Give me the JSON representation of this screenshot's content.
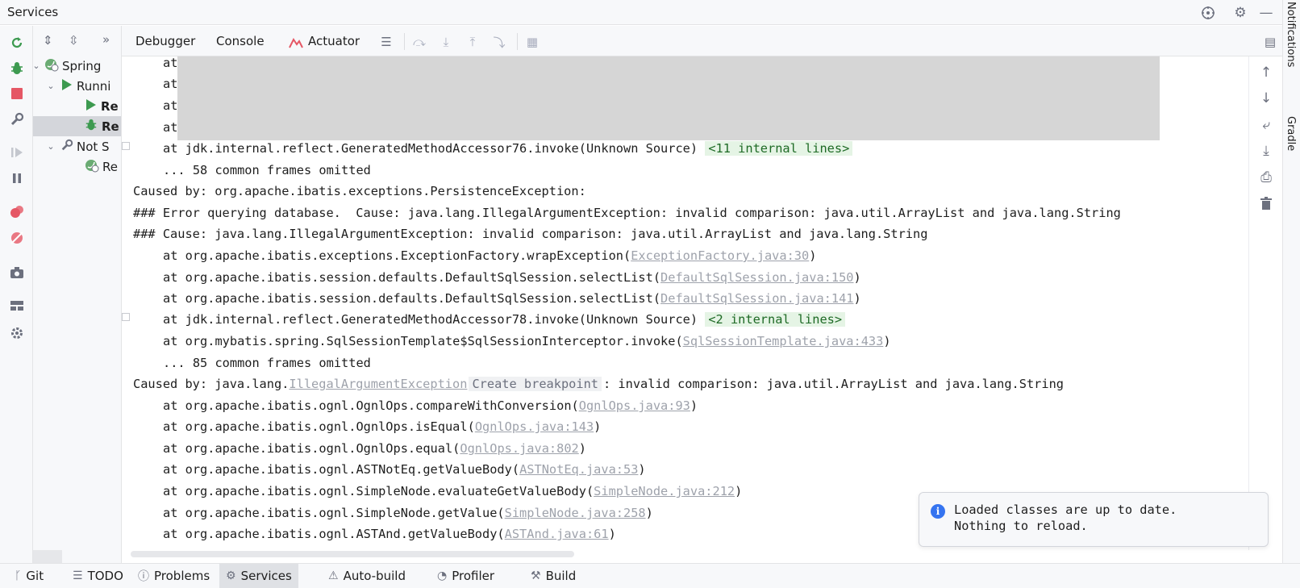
{
  "window": {
    "title": "Services"
  },
  "right_strip": {
    "notifications_label": "Notifications",
    "gradle_label": "Gradle"
  },
  "tree": {
    "items": [
      {
        "label": "Spring",
        "level": 0,
        "expanded": true
      },
      {
        "label": "Runni",
        "level": 1,
        "expanded": true
      },
      {
        "label": "Re",
        "level": 2,
        "state": "running"
      },
      {
        "label": "Re",
        "level": 2,
        "state": "debug",
        "selected": true
      },
      {
        "label": "Not S",
        "level": 1,
        "expanded": true
      },
      {
        "label": "Re",
        "level": 2,
        "state": "stopped"
      }
    ]
  },
  "toolbar": {
    "tabs": [
      "Debugger",
      "Console",
      "Actuator"
    ]
  },
  "console": {
    "redacted_prefix_lines": [
      "at",
      "at",
      "at",
      "at"
    ],
    "lines": [
      {
        "indent": true,
        "text": "at jdk.internal.reflect.GeneratedMethodAccessor76.invoke(Unknown Source)",
        "folded": "<11 internal lines>",
        "gutter": true
      },
      {
        "indent": true,
        "text": "... 58 common frames omitted"
      },
      {
        "indent": false,
        "text": "Caused by: org.apache.ibatis.exceptions.PersistenceException:"
      },
      {
        "indent": false,
        "text": "### Error querying database.  Cause: java.lang.IllegalArgumentException: invalid comparison: java.util.ArrayList and java.lang.String"
      },
      {
        "indent": false,
        "text": "### Cause: java.lang.IllegalArgumentException: invalid comparison: java.util.ArrayList and java.lang.String"
      },
      {
        "indent": true,
        "text": "at org.apache.ibatis.exceptions.ExceptionFactory.wrapException(",
        "link": "ExceptionFactory.java:30",
        "after": ")"
      },
      {
        "indent": true,
        "text": "at org.apache.ibatis.session.defaults.DefaultSqlSession.selectList(",
        "link": "DefaultSqlSession.java:150",
        "after": ")"
      },
      {
        "indent": true,
        "text": "at org.apache.ibatis.session.defaults.DefaultSqlSession.selectList(",
        "link": "DefaultSqlSession.java:141",
        "after": ")"
      },
      {
        "indent": true,
        "text": "at jdk.internal.reflect.GeneratedMethodAccessor78.invoke(Unknown Source)",
        "folded": "<2 internal lines>",
        "gutter": true
      },
      {
        "indent": true,
        "text": "at org.mybatis.spring.SqlSessionTemplate$SqlSessionInterceptor.invoke(",
        "link": "SqlSessionTemplate.java:433",
        "after": ")"
      },
      {
        "indent": true,
        "text": "... 85 common frames omitted"
      },
      {
        "indent": false,
        "text": "Caused by: java.lang.",
        "link": "IllegalArgumentException",
        "breakpoint": "Create breakpoint",
        "after": ": invalid comparison: java.util.ArrayList and java.lang.String"
      },
      {
        "indent": true,
        "text": "at org.apache.ibatis.ognl.OgnlOps.compareWithConversion(",
        "link": "OgnlOps.java:93",
        "after": ")"
      },
      {
        "indent": true,
        "text": "at org.apache.ibatis.ognl.OgnlOps.isEqual(",
        "link": "OgnlOps.java:143",
        "after": ")"
      },
      {
        "indent": true,
        "text": "at org.apache.ibatis.ognl.OgnlOps.equal(",
        "link": "OgnlOps.java:802",
        "after": ")"
      },
      {
        "indent": true,
        "text": "at org.apache.ibatis.ognl.ASTNotEq.getValueBody(",
        "link": "ASTNotEq.java:53",
        "after": ")"
      },
      {
        "indent": true,
        "text": "at org.apache.ibatis.ognl.SimpleNode.evaluateGetValueBody(",
        "link": "SimpleNode.java:212",
        "after": ")"
      },
      {
        "indent": true,
        "text": "at org.apache.ibatis.ognl.SimpleNode.getValue(",
        "link": "SimpleNode.java:258",
        "after": ")"
      },
      {
        "indent": true,
        "text": "at org.apache.ibatis.ognl.ASTAnd.getValueBody(",
        "link": "ASTAnd.java:61",
        "after": ")"
      }
    ]
  },
  "notification": {
    "line1": "Loaded classes are up to date.",
    "line2": "Nothing to reload."
  },
  "bottom_bar": {
    "items": [
      {
        "label": "Git",
        "icon": "git-icon"
      },
      {
        "label": "TODO",
        "icon": "list-icon"
      },
      {
        "label": "Problems",
        "icon": "problems-icon"
      },
      {
        "label": "Services",
        "icon": "services-icon",
        "active": true
      },
      {
        "label": "Auto-build",
        "icon": "warning-icon"
      },
      {
        "label": "Profiler",
        "icon": "profiler-icon"
      },
      {
        "label": "Build",
        "icon": "hammer-icon"
      }
    ]
  },
  "colors": {
    "accent_green": "#3d9a50",
    "accent_red": "#e55765",
    "accent_blue": "#3574f0",
    "link_gray": "#9ea2ab",
    "fold_bg": "#e5f4e5"
  }
}
